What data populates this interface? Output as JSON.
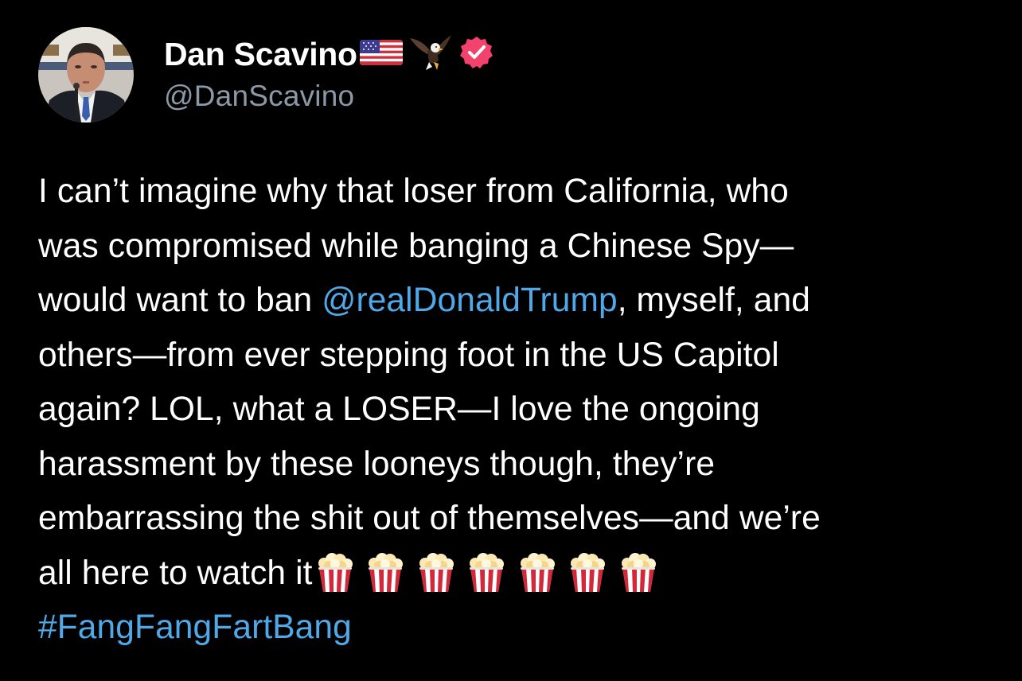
{
  "user": {
    "display_name": "Dan Scavino",
    "name_emojis": [
      "flag-usa-icon",
      "eagle-icon"
    ],
    "verified": true,
    "handle": "@DanScavino"
  },
  "tweet": {
    "lines": [
      "I can’t imagine why that loser from California, who",
      "was compromised while banging a Chinese Spy—",
      {
        "before": "would want to ban ",
        "mention": "@realDonaldTrump",
        "after": ", myself, and"
      },
      "others—from ever stepping foot in the US Capitol",
      "again? LOL, what a LOSER—I love the ongoing",
      "harassment by these looneys though, they’re",
      "embarrassing the shit out of themselves—and we’re",
      "all here to watch it"
    ],
    "popcorn_count": 7,
    "hashtag": "#FangFangFartBang"
  },
  "colors": {
    "background": "#000000",
    "text": "#ffffff",
    "handle": "#8b98a5",
    "link": "#4fa9e8",
    "verified_badge": "#f4426e"
  }
}
